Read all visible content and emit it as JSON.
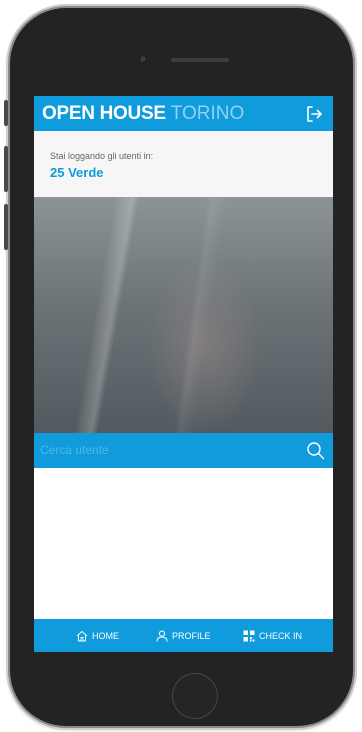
{
  "header": {
    "brand_bold": "OPEN HOUSE",
    "brand_light": "TORINO",
    "logout_icon": "logout-icon"
  },
  "logging": {
    "label": "Stai loggando gli utenti in:",
    "value": "25 Verde"
  },
  "search": {
    "placeholder": "Cerca utente",
    "value": "",
    "icon": "search-icon"
  },
  "nav": {
    "items": [
      {
        "label": "HOME",
        "icon": "home-icon"
      },
      {
        "label": "PROFILE",
        "icon": "profile-icon"
      },
      {
        "label": "CHECK IN",
        "icon": "qr-code-icon"
      }
    ]
  },
  "colors": {
    "accent": "#0f9bdc",
    "panel": "#f6f6f6",
    "brand_light": "#8fd2f3"
  }
}
